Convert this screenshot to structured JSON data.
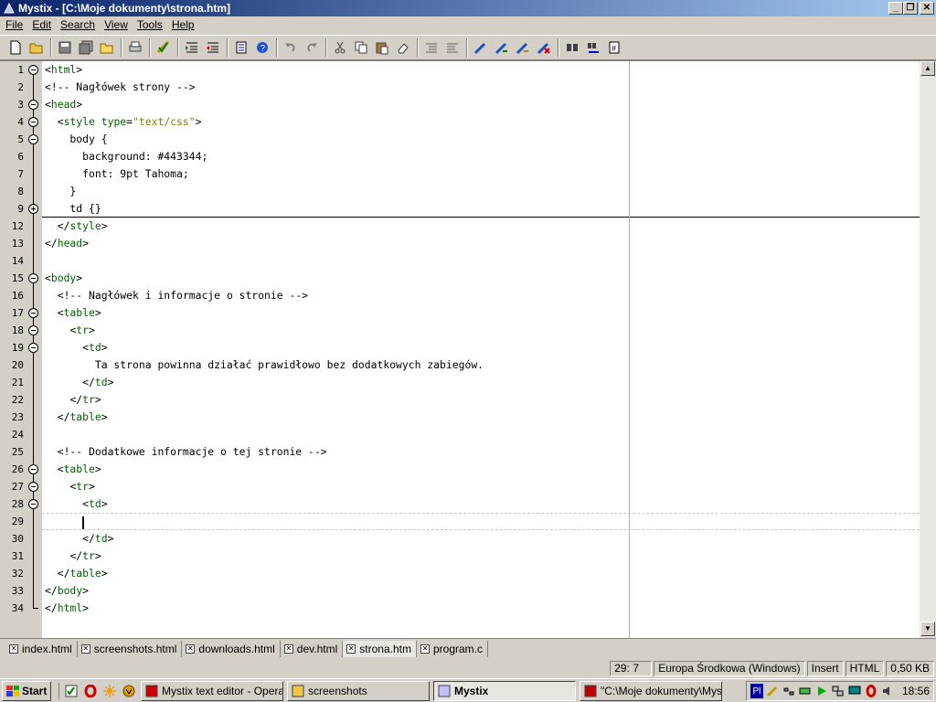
{
  "window": {
    "title": "Mystix - [C:\\Moje dokumenty\\strona.htm]"
  },
  "menu": [
    "File",
    "Edit",
    "Search",
    "View",
    "Tools",
    "Help"
  ],
  "toolbar": {
    "buttons": [
      "new-file",
      "open-file",
      "save",
      "save-all",
      "open-folder",
      "print",
      "spell-check",
      "indent-more",
      "indent-less",
      "list",
      "help",
      "undo",
      "redo",
      "cut",
      "copy",
      "paste",
      "clear",
      "comment",
      "uncomment",
      "bookmark-toggle",
      "bookmark-next",
      "bookmark-prev",
      "bookmark-clear",
      "find",
      "find-replace",
      "goto"
    ]
  },
  "editor": {
    "lines": [
      {
        "n": "1",
        "fold": "open",
        "text": "<html>"
      },
      {
        "n": "2",
        "fold": "line",
        "text": "<!-- Nagłówek strony -->"
      },
      {
        "n": "3",
        "fold": "open",
        "text": "<head>"
      },
      {
        "n": "4",
        "fold": "open",
        "text": "  <style type=\"text/css\">"
      },
      {
        "n": "5",
        "fold": "open",
        "text": "    body {"
      },
      {
        "n": "6",
        "fold": "line",
        "text": "      background: #443344;"
      },
      {
        "n": "7",
        "fold": "line",
        "text": "      font: 9pt Tahoma;"
      },
      {
        "n": "8",
        "fold": "line",
        "text": "    }"
      },
      {
        "n": "9",
        "fold": "plus",
        "text": "    td {}"
      },
      {
        "n": "12",
        "fold": "line",
        "text": "  </style>"
      },
      {
        "n": "13",
        "fold": "line",
        "text": "</head>"
      },
      {
        "n": "14",
        "fold": "line",
        "text": ""
      },
      {
        "n": "15",
        "fold": "open",
        "text": "<body>"
      },
      {
        "n": "16",
        "fold": "line",
        "text": "  <!-- Nagłówek i informacje o stronie -->"
      },
      {
        "n": "17",
        "fold": "open",
        "text": "  <table>"
      },
      {
        "n": "18",
        "fold": "open",
        "text": "    <tr>"
      },
      {
        "n": "19",
        "fold": "open",
        "text": "      <td>"
      },
      {
        "n": "20",
        "fold": "line",
        "text": "        Ta strona powinna działać prawidłowo bez dodatkowych zabiegów."
      },
      {
        "n": "21",
        "fold": "line",
        "text": "      </td>"
      },
      {
        "n": "22",
        "fold": "line",
        "text": "    </tr>"
      },
      {
        "n": "23",
        "fold": "line",
        "text": "  </table>"
      },
      {
        "n": "24",
        "fold": "line",
        "text": ""
      },
      {
        "n": "25",
        "fold": "line",
        "text": "  <!-- Dodatkowe informacje o tej stronie -->"
      },
      {
        "n": "26",
        "fold": "open",
        "text": "  <table>"
      },
      {
        "n": "27",
        "fold": "open",
        "text": "    <tr>"
      },
      {
        "n": "28",
        "fold": "open",
        "text": "      <td>"
      },
      {
        "n": "29",
        "fold": "line",
        "text": ""
      },
      {
        "n": "30",
        "fold": "line",
        "text": "      </td>"
      },
      {
        "n": "31",
        "fold": "line",
        "text": "    </tr>"
      },
      {
        "n": "32",
        "fold": "line",
        "text": "  </table>"
      },
      {
        "n": "33",
        "fold": "line",
        "text": "</body>"
      },
      {
        "n": "34",
        "fold": "end",
        "text": "</html>"
      }
    ],
    "current_line": "29",
    "folded_line": "9"
  },
  "tabs": [
    {
      "label": "index.html",
      "active": false
    },
    {
      "label": "screenshots.html",
      "active": false
    },
    {
      "label": "downloads.html",
      "active": false
    },
    {
      "label": "dev.html",
      "active": false
    },
    {
      "label": "strona.htm",
      "active": true
    },
    {
      "label": "program.c",
      "active": false
    }
  ],
  "status": {
    "position": "29:  7",
    "encoding": "Europa Środkowa (Windows)",
    "mode": "Insert",
    "syntax": "HTML",
    "size": "0,50 KB"
  },
  "taskbar": {
    "start_label": "Start",
    "tasks": [
      {
        "label": "Mystix text editor - Opera",
        "active": false
      },
      {
        "label": "screenshots",
        "active": false
      },
      {
        "label": "Mystix",
        "active": true
      },
      {
        "label": "\"C:\\Moje dokumenty\\Myst...",
        "active": false
      }
    ],
    "tray_language": "Pl",
    "clock": "18:56"
  },
  "colors": {
    "tag": "#006000",
    "attr_value": "#808000",
    "title_start": "#0a246a",
    "title_end": "#a6caf0",
    "current_line": "#ff9fff"
  }
}
